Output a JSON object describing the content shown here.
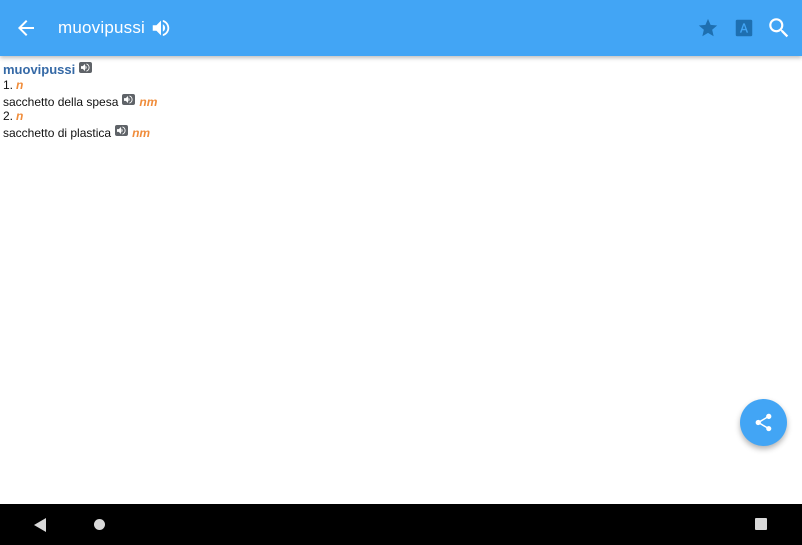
{
  "appbar": {
    "title": "muovipussi",
    "icons": [
      "arrow-back-icon",
      "volume-icon",
      "star-icon",
      "font-size-icon",
      "search-icon"
    ],
    "color": "#42a5f5"
  },
  "entry": {
    "headword": "muovipussi",
    "senses": [
      {
        "number": "1.",
        "pos": "n",
        "translation": "sacchetto della spesa",
        "gender": "nm"
      },
      {
        "number": "2.",
        "pos": "n",
        "translation": "sacchetto di plastica",
        "gender": "nm"
      }
    ],
    "headword_color": "#3569a6",
    "grammar_color": "#f08c3a"
  },
  "fab": {
    "icon": "share-icon"
  },
  "system_nav": {
    "icons": [
      "nav-back-icon",
      "nav-home-icon",
      "nav-recents-icon"
    ]
  }
}
